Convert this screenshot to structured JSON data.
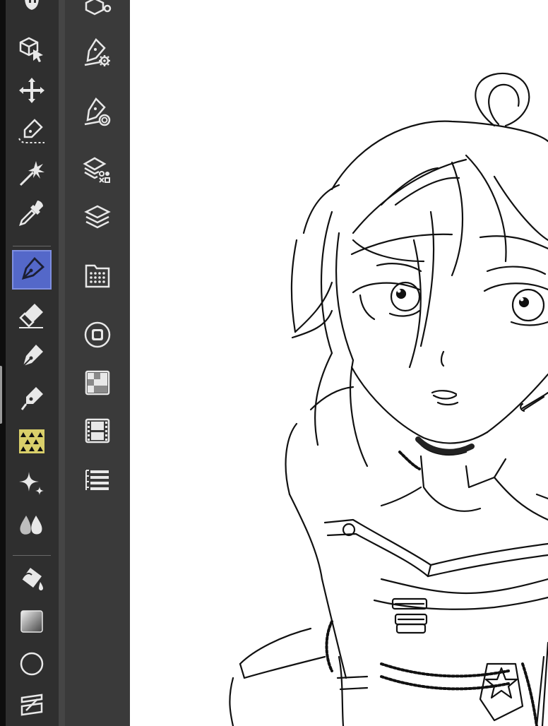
{
  "app": {
    "accent_color": "#5468c9",
    "toolbar_color": "#2f2f2f",
    "panel_color": "#3a3a3a"
  },
  "tools": [
    {
      "id": "hand",
      "icon": "hand-icon",
      "active": false
    },
    {
      "id": "object",
      "icon": "object-select-icon",
      "active": false
    },
    {
      "id": "move",
      "icon": "move-icon",
      "active": false
    },
    {
      "id": "selection-pen",
      "icon": "selection-pen-icon",
      "active": false
    },
    {
      "id": "auto-select",
      "icon": "magic-wand-icon",
      "active": false
    },
    {
      "id": "eyedropper",
      "icon": "eyedropper-icon",
      "active": false
    },
    {
      "id": "pen",
      "icon": "pen-nib-icon",
      "active": true
    },
    {
      "id": "eraser",
      "icon": "eraser-icon",
      "active": false
    },
    {
      "id": "brush",
      "icon": "brush-icon",
      "active": false
    },
    {
      "id": "airbrush",
      "icon": "airbrush-icon",
      "active": false
    },
    {
      "id": "decoration",
      "icon": "decoration-pattern-icon",
      "active": false
    },
    {
      "id": "sparkle",
      "icon": "sparkle-icon",
      "active": false
    },
    {
      "id": "blend",
      "icon": "blend-drops-icon",
      "active": false
    },
    {
      "id": "fill",
      "icon": "fill-bucket-icon",
      "active": false
    },
    {
      "id": "gradient",
      "icon": "gradient-icon",
      "active": false
    },
    {
      "id": "figure",
      "icon": "circle-shape-icon",
      "active": false
    },
    {
      "id": "ruler",
      "icon": "ruler-icon",
      "active": false
    }
  ],
  "panels": [
    {
      "id": "sub-tool",
      "icon": "sub-tool-icon"
    },
    {
      "id": "tool-property",
      "icon": "tool-property-icon"
    },
    {
      "id": "brush-size",
      "icon": "brush-size-icon"
    },
    {
      "id": "layer-property",
      "icon": "layer-property-icon"
    },
    {
      "id": "layer",
      "icon": "layer-stack-icon"
    },
    {
      "id": "material",
      "icon": "material-folder-icon"
    },
    {
      "id": "navigator",
      "icon": "navigator-icon"
    },
    {
      "id": "color-set",
      "icon": "color-set-icon"
    },
    {
      "id": "timeline",
      "icon": "film-icon"
    },
    {
      "id": "history",
      "icon": "history-list-icon"
    }
  ]
}
